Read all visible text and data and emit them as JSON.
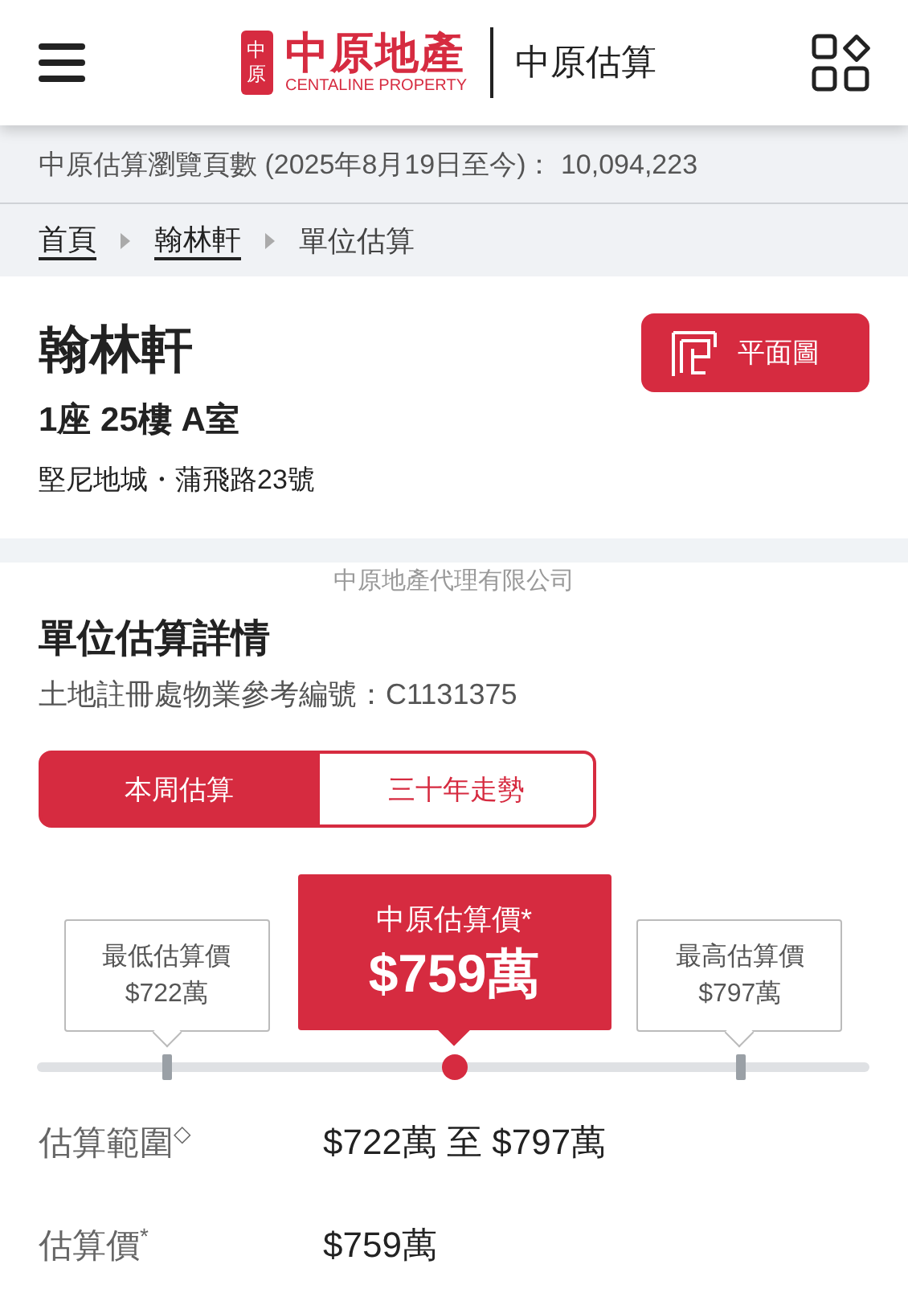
{
  "header": {
    "logo_seal": [
      "中",
      "原"
    ],
    "logo_name": "中原地產",
    "logo_subtitle": "CENTALINE PROPERTY",
    "app_title": "中原估算"
  },
  "page_views": {
    "label": "中原估算瀏覽頁數 (2025年8月19日至今)：",
    "value": "10,094,223"
  },
  "breadcrumb": [
    {
      "label": "首頁",
      "link": true
    },
    {
      "label": "翰林軒",
      "link": true
    },
    {
      "label": "單位估算",
      "link": false
    }
  ],
  "property": {
    "name": "翰林軒",
    "unit": "1座 25樓 A室",
    "address": "堅尼地城・蒲飛路23號",
    "floor_plan_button": "平面圖"
  },
  "credit": "中原地產代理有限公司",
  "valuation": {
    "title": "單位估算詳情",
    "reference": "土地註冊處物業參考編號：C1131375",
    "tabs": [
      {
        "label": "本周估算",
        "selected": true
      },
      {
        "label": "三十年走勢",
        "selected": false
      }
    ],
    "scale": [
      {
        "kind": "low",
        "label": "最低估算價",
        "value": "$722萬",
        "level": 0.156
      },
      {
        "kind": "main",
        "label": "中原估算價*",
        "value": "$759萬",
        "level": 0.502
      },
      {
        "kind": "high",
        "label": "最高估算價",
        "value": "$797萬",
        "level": 0.846
      }
    ],
    "details": [
      {
        "label": "估算範圍$^{◇}$",
        "value": "$722萬 至 $797萬"
      },
      {
        "label": "估算價$^{*}$",
        "value": "$759萬"
      }
    ]
  }
}
